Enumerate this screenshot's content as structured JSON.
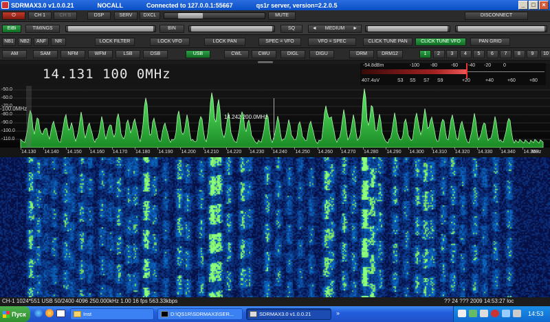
{
  "window": {
    "app": "SDRMAX3.0 v1.0.0.21",
    "callsign": "NOCALL",
    "connection": "Connected to 127.0.0.1:55667",
    "server": "qs1r server, version=2.2.0.5",
    "controls": [
      "_",
      "□",
      "×"
    ]
  },
  "row1": {
    "ch": "CH 1",
    "chs": "CH S",
    "dsp": "DSP",
    "serv": "SERV",
    "dxcl": "DXCL",
    "mute": "MUTE",
    "disconnect": "DISCONNECT",
    "volume_level": 0.18
  },
  "row2": {
    "eibi": "EiBi",
    "timings": "TIMINGS",
    "bin": "BIN",
    "sq": "SQ",
    "agc_left": "◄",
    "agc": "MEDIUM",
    "agc_right": "►"
  },
  "row3": {
    "buttons": [
      "NB1",
      "NB2",
      "ANF",
      "NR",
      "LOCK FILTER",
      "LOCK VFO",
      "LOCK PAN",
      "SPEC = VFO",
      "VFO = SPEC",
      "CLICK TUNE PAN",
      "CLICK TUNE VFO",
      "PAN GRID"
    ]
  },
  "row4": {
    "modes": [
      "AM",
      "SAM",
      "NFM",
      "WFM",
      "LSB",
      "DSB",
      "USB",
      "CWL",
      "CWU",
      "DIGL",
      "DIGU",
      "DRM",
      "DRM12"
    ],
    "active_mode": "USB",
    "memories": [
      "1",
      "2",
      "3",
      "4",
      "5",
      "6",
      "7",
      "8",
      "9",
      "10"
    ],
    "active_memory": "1"
  },
  "frequency": "14.131 100 0MHz",
  "smeter": {
    "dbm": "-54.8dBm",
    "top_scale": [
      "-100",
      "-80",
      "-60",
      "-40",
      "-20",
      "0"
    ],
    "uv": "407.4uV",
    "bottom_scale": [
      "S3",
      "S5",
      "S7",
      "S9",
      "+20",
      "+40",
      "+60",
      "+80"
    ],
    "level": 0.57
  },
  "spectrum": {
    "y_labels": [
      "-50.0",
      "-60.0",
      "-70.0",
      "-80.0",
      "-90.0",
      "-100.0",
      "-110.0"
    ],
    "y_overlay": "-100.0MHz",
    "cursor_label": "14.242 200.0MHz",
    "x_labels": [
      "14.130",
      "14.140",
      "14.150",
      "14.160",
      "14.170",
      "14.180",
      "14.190",
      "14.200",
      "14.210",
      "14.220",
      "14.230",
      "14.240",
      "14.250",
      "14.260",
      "14.270",
      "14.280",
      "14.290",
      "14.300",
      "14.310",
      "14.320",
      "14.330",
      "14.340",
      "14.350"
    ],
    "x_unit": "MHz",
    "colors": {
      "trace": "#5ef06a",
      "fill": "#1a8a25",
      "waterfall_bg": "#061046",
      "waterfall_hot": "#6cff6c"
    }
  },
  "status": {
    "left": "CH-1 1024*551 USB 50/2400 4096 250.000kHz 1.00 16 fps  563.33kbps",
    "right": "?? 24 ??? 2009  14:53:27  loc"
  },
  "taskbar": {
    "start": "Пуск",
    "tasks": [
      "Inst",
      "D:\\QS1R\\SDRMAX3\\SER...",
      "SDRMAX3.0 v1.0.0.21",
      "»"
    ],
    "active_task": "SDRMAX3.0 v1.0.0.21",
    "clock": "14:53"
  }
}
